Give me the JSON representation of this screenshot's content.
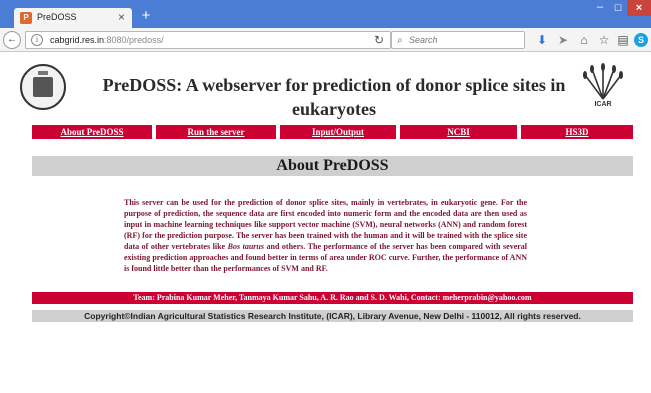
{
  "browser": {
    "tab_title": "PreDOSS",
    "tab_favicon": "P",
    "url_host": "cabgrid.res.in",
    "url_path": ":8080/predoss/",
    "search_placeholder": "Search",
    "icons": {
      "back": "back-arrow-icon",
      "info": "info-icon",
      "reload": "reload-icon",
      "search": "search-icon",
      "download": "download-icon",
      "send": "send-icon",
      "home": "home-icon",
      "bookmark": "star-icon",
      "library": "library-icon",
      "skype": "skype-icon",
      "menu": "hamburger-menu-icon"
    },
    "colors": {
      "titlebar": "#4b7dd5",
      "close": "#c9443a"
    }
  },
  "site": {
    "title": "PreDOSS: A webserver for prediction of donor splice sites in eukaryotes",
    "logo_right_text": "ICAR",
    "nav": [
      {
        "label": "About PreDOSS"
      },
      {
        "label": "Run the server"
      },
      {
        "label": "Input/Output"
      },
      {
        "label": "NCBI"
      },
      {
        "label": "HS3D"
      }
    ],
    "section_title": "About PreDOSS",
    "description_before_italic": "This server can be used for the prediction of donor splice sites, mainly in vertebrates, in eukaryotic gene. For the purpose of prediction, the sequence data are first encoded into numeric form and the encoded data are then used as input in machine learning techniques like support vector machine (SVM), neural networks (ANN) and random forest (RF) for the prediction purpose. The server has been trained with the human and it will be trained with the splice site data of other vertebrates like ",
    "description_italic": "Bos taurus",
    "description_after_italic": " and others. The performance of the server has been compared with several existing prediction approaches and found better in terms of area under ROC curve. Further, the performance of ANN is found little better than the performances of SVM and RF.",
    "team": "Team: Prabina Kumar Meher, Tanmaya Kumar Sahu, A. R. Rao and S. D. Wahi, Contact: meherprabin@yahoo.com",
    "copyright": "Copyright©Indian Agricultural Statistics Research Institute, (ICAR), Library Avenue, New Delhi - 110012, All rights reserved.",
    "colors": {
      "accent_red": "#cc0033",
      "header_grey": "#cfcfcf",
      "description_text": "#7a1430"
    }
  }
}
